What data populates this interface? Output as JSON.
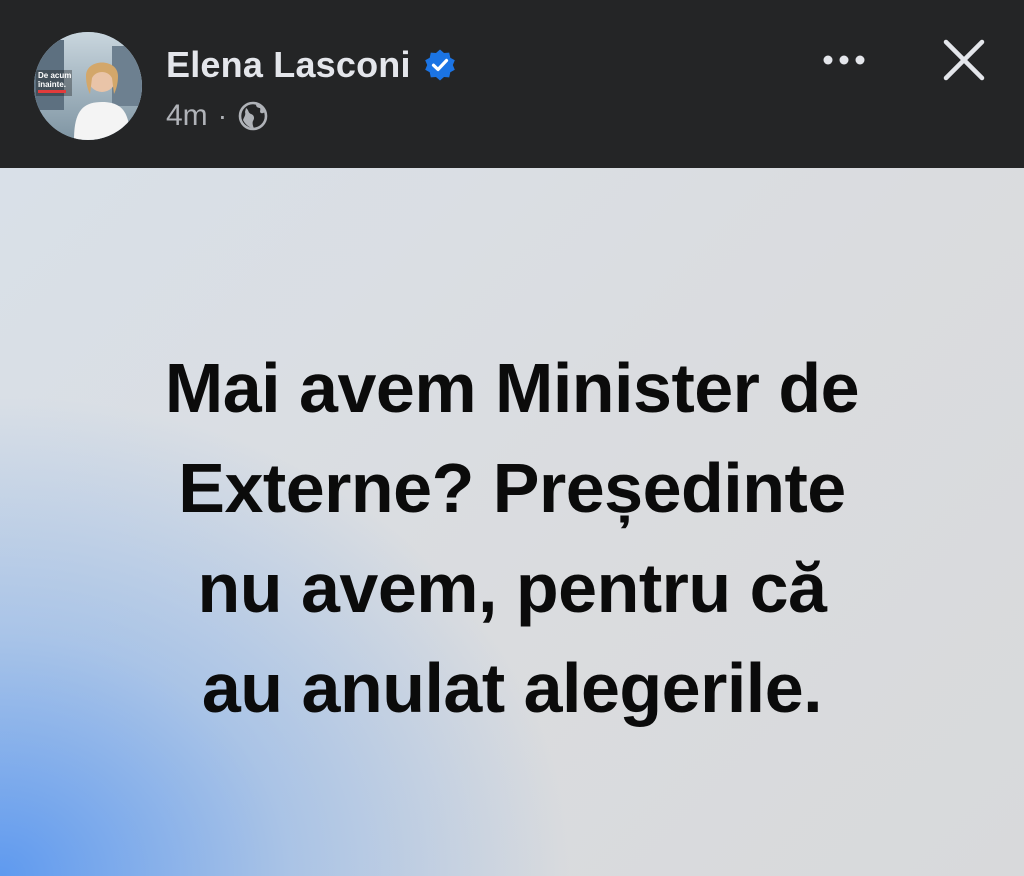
{
  "post": {
    "author_name": "Elena Lasconi",
    "timestamp": "4m",
    "separator": "·",
    "audience_icon": "globe-icon",
    "verified_icon": "verified-badge-icon",
    "avatar_caption_line1": "De acum",
    "avatar_caption_line2": "înainte.",
    "text_lines": [
      "Mai avem Minister de",
      "Externe? Președinte",
      "nu avem, pentru că",
      "au anulat alegerile."
    ]
  },
  "header": {
    "more_icon": "more-options-icon",
    "close_icon": "close-icon"
  },
  "colors": {
    "header_bg": "#242526",
    "author_text": "#e4e6eb",
    "meta_text": "#b0b3b8",
    "verified_blue": "#1b74e4",
    "post_text": "#0b0b0b"
  }
}
